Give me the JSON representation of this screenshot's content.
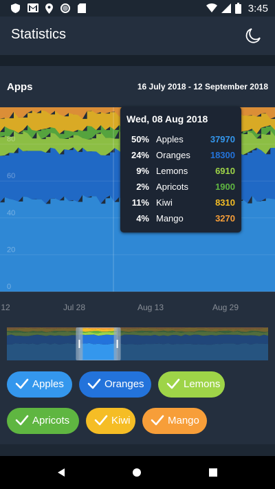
{
  "status_bar": {
    "time": "3:45"
  },
  "app_bar": {
    "title": "Statistics",
    "night_mode_icon": "moon-icon"
  },
  "card": {
    "title": "Apps",
    "date_range": "16 July 2018 - 12 September 2018"
  },
  "chart_data": {
    "type": "area",
    "y_tick_labels": [
      "80",
      "60",
      "40",
      "20",
      "0"
    ],
    "x_tick_labels": [
      "12",
      "Jul 28",
      "Aug 13",
      "Aug 29"
    ],
    "ylim": [
      0,
      100
    ],
    "stacked_percent": true,
    "series": [
      {
        "name": "Apples",
        "color": "#3497ed"
      },
      {
        "name": "Oranges",
        "color": "#2373db"
      },
      {
        "name": "Lemons",
        "color": "#9ed448"
      },
      {
        "name": "Apricots",
        "color": "#5fb641"
      },
      {
        "name": "Kiwi",
        "color": "#f5bd25"
      },
      {
        "name": "Mango",
        "color": "#f79e39"
      }
    ],
    "tooltip": {
      "date": "Wed, 08 Aug 2018",
      "rows": [
        {
          "pct": "50%",
          "name": "Apples",
          "value": "37970",
          "color": "#3497ed"
        },
        {
          "pct": "24%",
          "name": "Oranges",
          "value": "18300",
          "color": "#2373db"
        },
        {
          "pct": "9%",
          "name": "Lemons",
          "value": "6910",
          "color": "#9ed448"
        },
        {
          "pct": "2%",
          "name": "Apricots",
          "value": "1900",
          "color": "#5fb641"
        },
        {
          "pct": "11%",
          "name": "Kiwi",
          "value": "8310",
          "color": "#f5bd25"
        },
        {
          "pct": "4%",
          "name": "Mango",
          "value": "3270",
          "color": "#f79e39"
        }
      ]
    }
  },
  "filters": [
    {
      "label": "Apples",
      "color": "#3497ed",
      "checked": true
    },
    {
      "label": "Oranges",
      "color": "#2373db",
      "checked": true
    },
    {
      "label": "Lemons",
      "color": "#9ed448",
      "checked": true
    },
    {
      "label": "Apricots",
      "color": "#5fb641",
      "checked": true
    },
    {
      "label": "Kiwi",
      "color": "#f5bd25",
      "checked": true
    },
    {
      "label": "Mango",
      "color": "#f79e39",
      "checked": true
    }
  ],
  "navigator": {
    "selected_range_fraction": [
      0.28,
      0.42
    ]
  },
  "bottom_nav": {
    "back_icon": "back-icon",
    "home_icon": "home-icon",
    "recents_icon": "recents-icon"
  }
}
